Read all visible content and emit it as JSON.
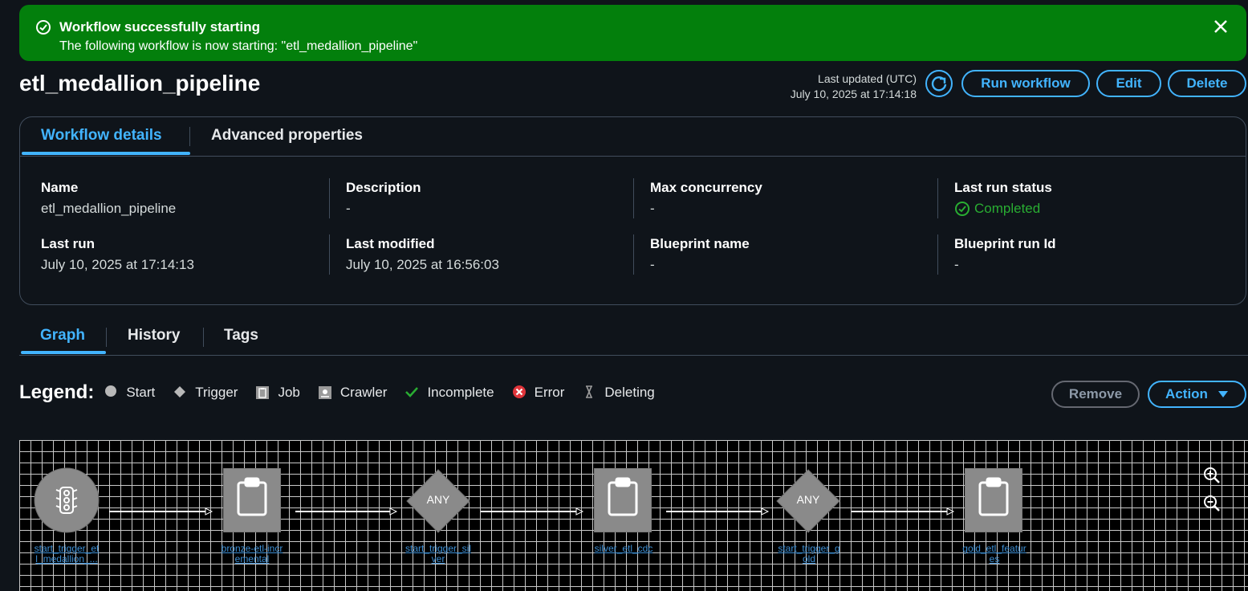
{
  "flash": {
    "title": "Workflow successfully starting",
    "message": "The following workflow is now starting: \"etl_medallion_pipeline\""
  },
  "header": {
    "title": "etl_medallion_pipeline",
    "last_updated_label": "Last updated (UTC)",
    "last_updated_value": "July 10, 2025 at 17:14:18",
    "run_label": "Run workflow",
    "edit_label": "Edit",
    "delete_label": "Delete"
  },
  "details_tabs": [
    "Workflow details",
    "Advanced properties"
  ],
  "fields": {
    "name": {
      "label": "Name",
      "value": "etl_medallion_pipeline"
    },
    "description": {
      "label": "Description",
      "value": "-"
    },
    "max_concurrency": {
      "label": "Max concurrency",
      "value": "-"
    },
    "last_run_status": {
      "label": "Last run status",
      "value": "Completed"
    },
    "last_run": {
      "label": "Last run",
      "value": "July 10, 2025 at 17:14:13"
    },
    "last_modified": {
      "label": "Last modified",
      "value": "July 10, 2025 at 16:56:03"
    },
    "blueprint_name": {
      "label": "Blueprint name",
      "value": "-"
    },
    "blueprint_run_id": {
      "label": "Blueprint run Id",
      "value": "-"
    }
  },
  "graph_tabs": [
    "Graph",
    "History",
    "Tags"
  ],
  "legend": {
    "title": "Legend:",
    "items": [
      "Start",
      "Trigger",
      "Job",
      "Crawler",
      "Incomplete",
      "Error",
      "Deleting"
    ]
  },
  "actions": {
    "remove_label": "Remove",
    "action_label": "Action"
  },
  "graph": {
    "nodes": [
      {
        "type": "start",
        "label_line1": "start_trigger_et",
        "label_line2": "l_medallion_..."
      },
      {
        "type": "job",
        "label_line1": "bronze-etl-incr",
        "label_line2": "emental"
      },
      {
        "type": "trigger",
        "badge": "ANY",
        "label_line1": "start_trigger_sil",
        "label_line2": "ver"
      },
      {
        "type": "job",
        "label_line1": "silver_etl_cdc",
        "label_line2": ""
      },
      {
        "type": "trigger",
        "badge": "ANY",
        "label_line1": "start_trigger_g",
        "label_line2": "old"
      },
      {
        "type": "job",
        "label_line1": "gold_etl_featur",
        "label_line2": "es"
      }
    ]
  },
  "colors": {
    "accent": "#42b4ff",
    "success": "#037f0c",
    "status_green": "#29ad32",
    "node_gray": "#8a8a8a"
  },
  "icons": [
    "check-circle-icon",
    "close-icon",
    "refresh-icon",
    "traffic-light-icon",
    "clipboard-icon",
    "zoom-in-icon",
    "zoom-out-icon",
    "caret-down-icon"
  ]
}
